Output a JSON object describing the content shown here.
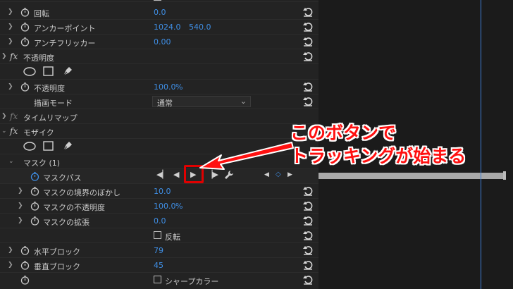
{
  "rows": {
    "rotation": {
      "label": "回転",
      "value": "0.0"
    },
    "anchor": {
      "label": "アンカーポイント",
      "x": "1024.0",
      "y": "540.0"
    },
    "antiflicker": {
      "label": "アンチフリッカー",
      "value": "0.00"
    },
    "opacity_fx": {
      "label": "不透明度"
    },
    "opacity": {
      "label": "不透明度",
      "value": "100.0",
      "unit": "%"
    },
    "blend": {
      "label": "描画モード",
      "value": "通常"
    },
    "timeremap": {
      "label": "タイムリマップ"
    },
    "mosaic": {
      "label": "モザイク"
    },
    "mask": {
      "label": "マスク (1)"
    },
    "maskpath": {
      "label": "マスクパス"
    },
    "feather": {
      "label": "マスクの境界のぼかし",
      "value": "10.0"
    },
    "maskopacity": {
      "label": "マスクの不透明度",
      "value": "100.0",
      "unit": "%"
    },
    "expansion": {
      "label": "マスクの拡張",
      "value": "0.0"
    },
    "invert": {
      "label": "反転"
    },
    "hblocks": {
      "label": "水平ブロック",
      "value": "79"
    },
    "vblocks": {
      "label": "垂直ブロック",
      "value": "45"
    },
    "sharp": {
      "label": "シャープカラー"
    }
  },
  "annotation": {
    "line1": "このボタンで",
    "line2": "トラッキングが始まる"
  },
  "colors": {
    "accent": "#3f8fe6",
    "highlight": "#e00000"
  }
}
